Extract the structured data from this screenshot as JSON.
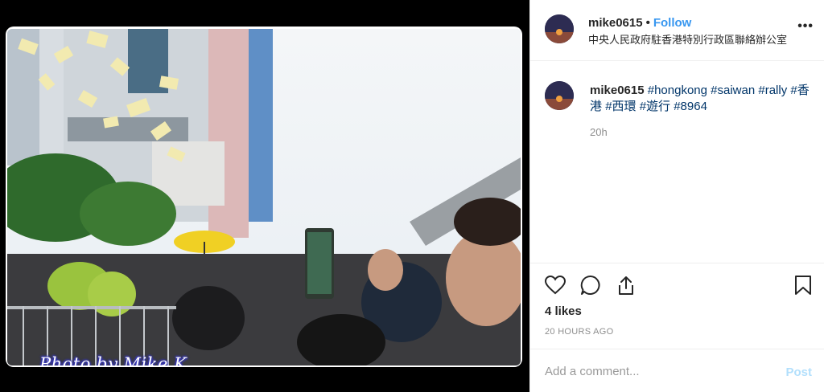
{
  "post": {
    "watermark": "Photo by Mike K."
  },
  "header": {
    "username": "mike0615",
    "separator": "•",
    "follow_label": "Follow",
    "location": "中央人民政府駐香港特別行政區聯絡辦公室",
    "more_label": "•••"
  },
  "caption": {
    "username": "mike0615",
    "hashtags": [
      "#hongkong",
      "#saiwan",
      "#rally",
      "#香港",
      "#西環",
      "#遊行",
      "#8964"
    ],
    "time": "20h"
  },
  "actions": {
    "likes": "4 likes",
    "posted_ago": "20 HOURS AGO",
    "icons": [
      "heart-icon",
      "comment-icon",
      "share-icon",
      "bookmark-icon"
    ]
  },
  "comment": {
    "placeholder": "Add a comment...",
    "post_label": "Post"
  },
  "colors": {
    "link": "#3897f0",
    "hashtag": "#003569",
    "muted": "#8e8e8e",
    "post_disabled": "#b2dffc"
  }
}
